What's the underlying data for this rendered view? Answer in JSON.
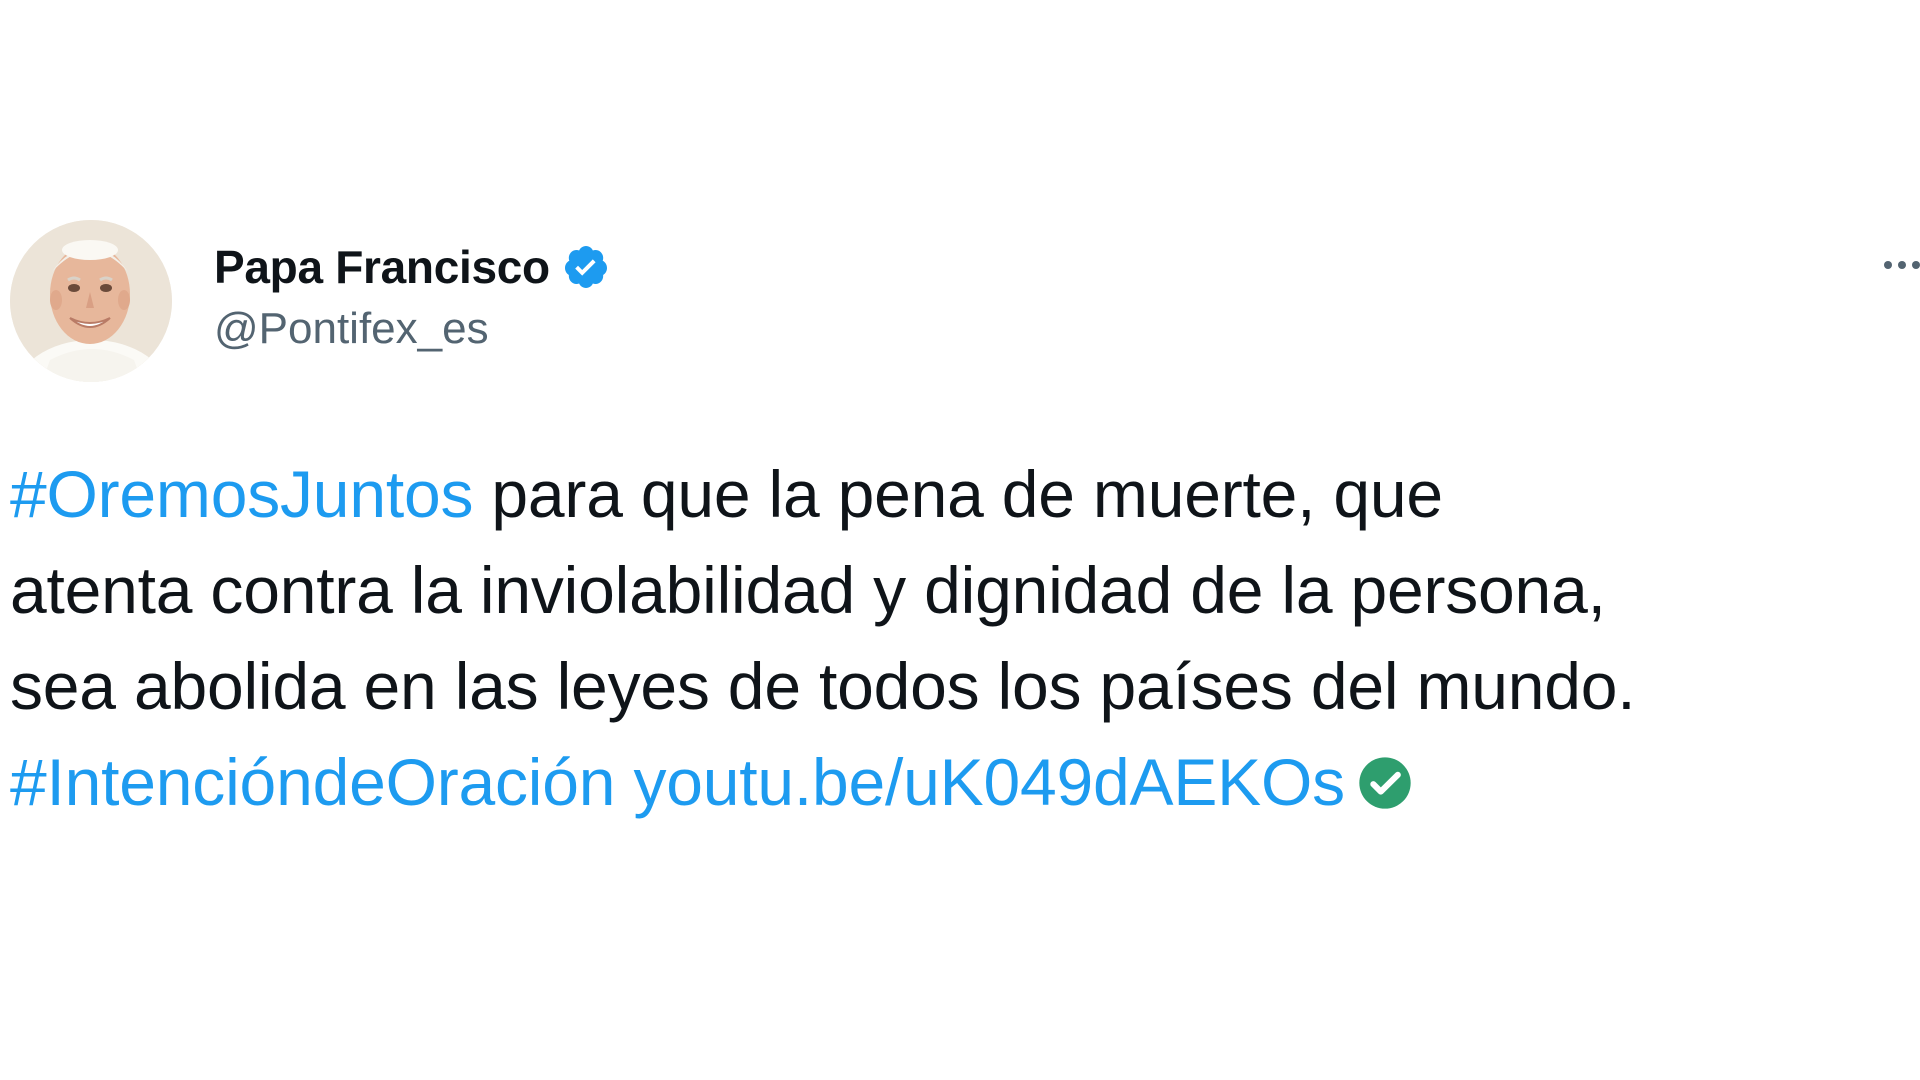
{
  "author": {
    "display_name": "Papa Francisco",
    "handle": "@Pontifex_es",
    "verified": true,
    "avatar_icon": "pope-portrait-avatar"
  },
  "menu": {
    "icon": "more-options-icon"
  },
  "tweet": {
    "hashtag_1": "#OremosJuntos",
    "line_1_text": " para que la pena de muerte, que",
    "line_2_text": "atenta contra la inviolabilidad y dignidad de la persona,",
    "line_3_text": "sea abolida en las leyes de todos los países del mundo.",
    "hashtag_2": "#IntencióndeOración",
    "link_text": "youtu.be/uK049dAEKOs",
    "link_badge_icon": "green-check-icon"
  },
  "colors": {
    "link": "#1d9bf0",
    "text": "#0f1419",
    "muted": "#536471",
    "verified_badge": "#1d9bf0",
    "check_badge": "#2e9e6e"
  }
}
